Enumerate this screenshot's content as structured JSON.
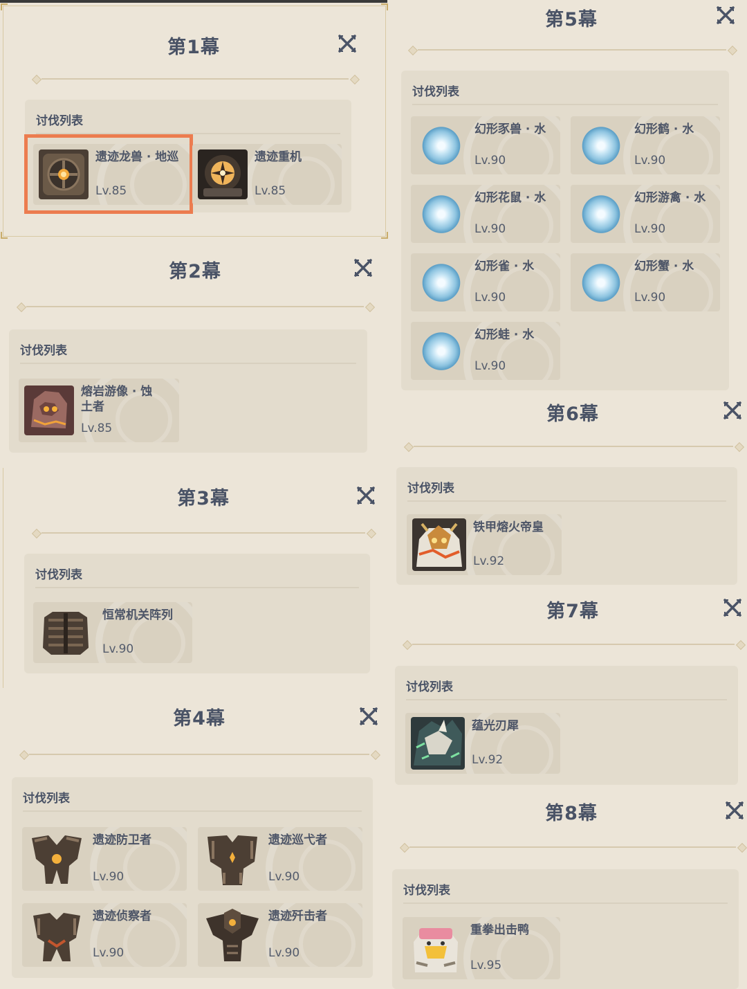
{
  "list_header": "讨伐列表",
  "acts": [
    {
      "title": "第1幕",
      "enemies": [
        {
          "name": "遗迹龙兽 · 地巡",
          "level": "Lv.85",
          "icon": "ruin-drake-earthguard-icon"
        },
        {
          "name": "遗迹重机",
          "level": "Lv.85",
          "icon": "ruin-grader-icon"
        }
      ]
    },
    {
      "title": "第2幕",
      "enemies": [
        {
          "name": "熔岩游像 · 蚀土者",
          "level": "Lv.85",
          "icon": "lava-dragon-statue-icon"
        }
      ]
    },
    {
      "title": "第3幕",
      "enemies": [
        {
          "name": "恒常机关阵列",
          "level": "Lv.90",
          "icon": "perpetual-mechanical-array-icon"
        }
      ]
    },
    {
      "title": "第4幕",
      "enemies": [
        {
          "name": "遗迹防卫者",
          "level": "Lv.90",
          "icon": "ruin-defender-icon"
        },
        {
          "name": "遗迹巡弋者",
          "level": "Lv.90",
          "icon": "ruin-cruiser-icon"
        },
        {
          "name": "遗迹侦察者",
          "level": "Lv.90",
          "icon": "ruin-scout-icon"
        },
        {
          "name": "遗迹歼击者",
          "level": "Lv.90",
          "icon": "ruin-destroyer-icon"
        }
      ]
    },
    {
      "title": "第5幕",
      "enemies": [
        {
          "name": "幻形豕兽 · 水",
          "level": "Lv.90",
          "icon": "hydro-mimic-boar-icon"
        },
        {
          "name": "幻形鹤 · 水",
          "level": "Lv.90",
          "icon": "hydro-mimic-crane-icon"
        },
        {
          "name": "幻形花鼠 · 水",
          "level": "Lv.90",
          "icon": "hydro-mimic-squirrel-icon"
        },
        {
          "name": "幻形游禽 · 水",
          "level": "Lv.90",
          "icon": "hydro-mimic-mallard-icon"
        },
        {
          "name": "幻形雀 · 水",
          "level": "Lv.90",
          "icon": "hydro-mimic-finch-icon"
        },
        {
          "name": "幻形蟹 · 水",
          "level": "Lv.90",
          "icon": "hydro-mimic-crab-icon"
        },
        {
          "name": "幻形蛙 · 水",
          "level": "Lv.90",
          "icon": "hydro-mimic-frog-icon"
        }
      ]
    },
    {
      "title": "第6幕",
      "enemies": [
        {
          "name": "铁甲熔火帝皇",
          "level": "Lv.92",
          "icon": "magma-crab-emperor-icon"
        }
      ]
    },
    {
      "title": "第7幕",
      "enemies": [
        {
          "name": "蕴光刃犀",
          "level": "Lv.92",
          "icon": "light-blade-rhino-icon"
        }
      ]
    },
    {
      "title": "第8幕",
      "enemies": [
        {
          "name": "重拳出击鸭",
          "level": "Lv.95",
          "icon": "punching-duck-icon"
        }
      ]
    }
  ],
  "colors": {
    "background": "#ece5d8",
    "card": "#e3dccd",
    "tile": "#d9d1c0",
    "text": "#4a5366",
    "highlight": "#ec7c4f"
  }
}
